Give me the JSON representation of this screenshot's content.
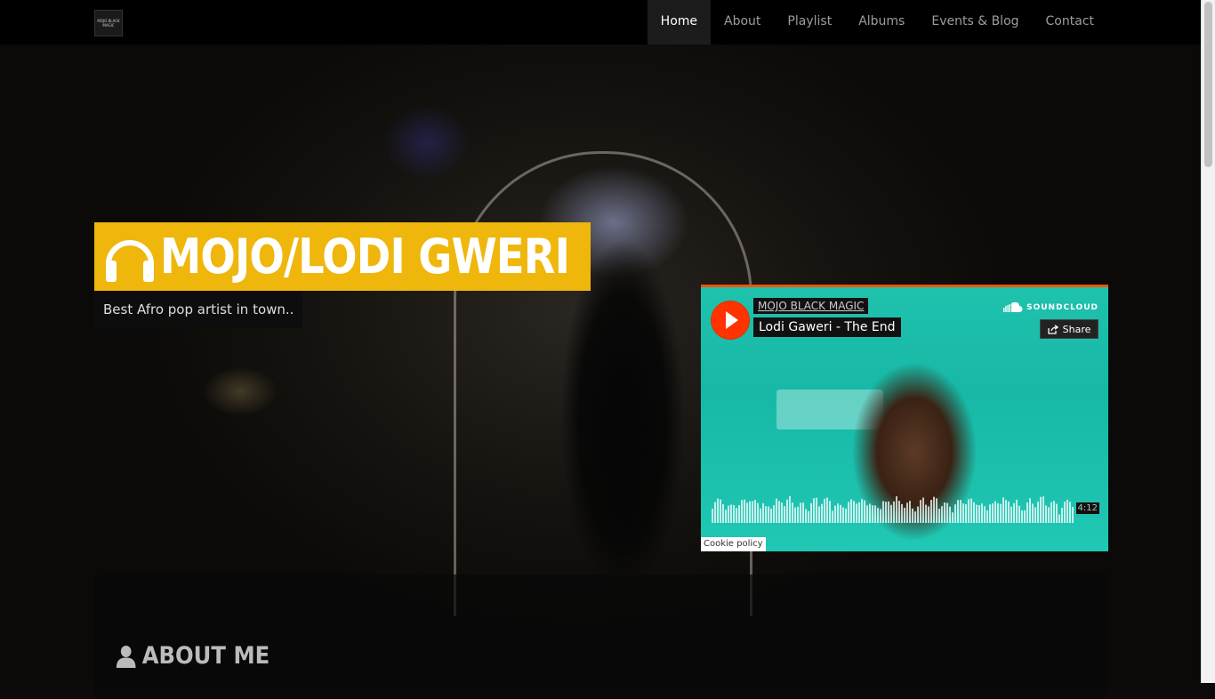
{
  "brand": {
    "logo_text": "MOJO BLACK MAGIC"
  },
  "nav": {
    "items": [
      {
        "label": "Home",
        "active": true
      },
      {
        "label": "About",
        "active": false
      },
      {
        "label": "Playlist",
        "active": false
      },
      {
        "label": "Albums",
        "active": false
      },
      {
        "label": "Events & Blog",
        "active": false
      },
      {
        "label": "Contact",
        "active": false
      }
    ]
  },
  "hero": {
    "title": "MOJO/LODI GWERI",
    "title_icon": "headphones-icon",
    "subtitle": "Best Afro pop artist in town.."
  },
  "player": {
    "artist": "MOJO BLACK MAGIC",
    "track": "Lodi Gaweri - The End",
    "brand": "SOUNDCLOUD",
    "share_label": "Share",
    "duration": "4:12",
    "cookie_policy": "Cookie policy"
  },
  "about": {
    "heading": "ABOUT ME",
    "icon": "user-icon"
  },
  "colors": {
    "accent": "#efb60c",
    "soundcloud_orange": "#ff5500",
    "nav_bg": "#000000"
  }
}
